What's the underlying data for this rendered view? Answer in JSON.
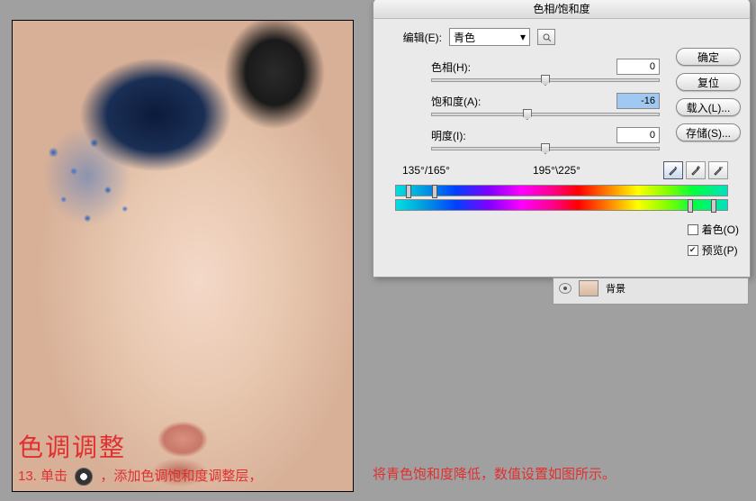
{
  "canvas": {
    "overlay_title": "色调调整",
    "overlay_step": "13. 单击",
    "overlay_suffix": "，添加色调饱和度调整层，"
  },
  "dialog": {
    "title": "色相/饱和度",
    "edit_label": "编辑(E):",
    "edit_value": "青色",
    "hue_label": "色相(H):",
    "hue_value": "0",
    "sat_label": "饱和度(A):",
    "sat_value": "-16",
    "light_label": "明度(I):",
    "light_value": "0",
    "range_left": "135°/165°",
    "range_right": "195°\\225°",
    "btn_ok": "确定",
    "btn_reset": "复位",
    "btn_load": "载入(L)...",
    "btn_save": "存储(S)...",
    "check_colorize": "着色(O)",
    "check_preview": "预览(P)"
  },
  "layers": {
    "bg_label": "背景"
  },
  "instruction": "将青色饱和度降低，数值设置如图所示。"
}
